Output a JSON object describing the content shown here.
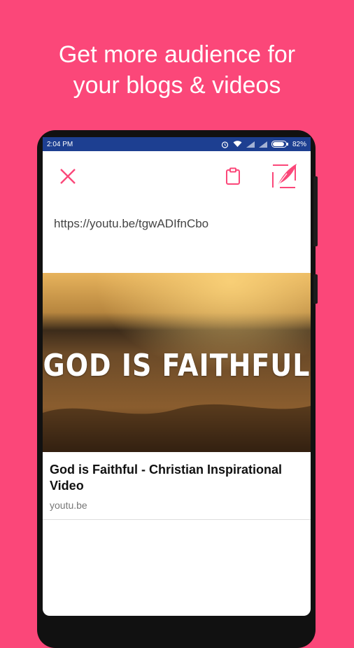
{
  "headline": {
    "line1": "Get more audience for",
    "line2": "your blogs & videos"
  },
  "status": {
    "time": "2:04 PM",
    "battery": "82%"
  },
  "toolbar": {
    "close_icon": "close-icon",
    "clipboard_icon": "clipboard-icon",
    "compose_icon": "quill-icon"
  },
  "link": {
    "url": "https://youtu.be/tgwADIfnCbo",
    "thumbnail_text": "GOD IS FAITHFUL",
    "title": "God is Faithful - Christian Inspirational Video",
    "domain": "youtu.be"
  },
  "colors": {
    "accent": "#fb4779",
    "statusbar": "#1d3f91"
  }
}
